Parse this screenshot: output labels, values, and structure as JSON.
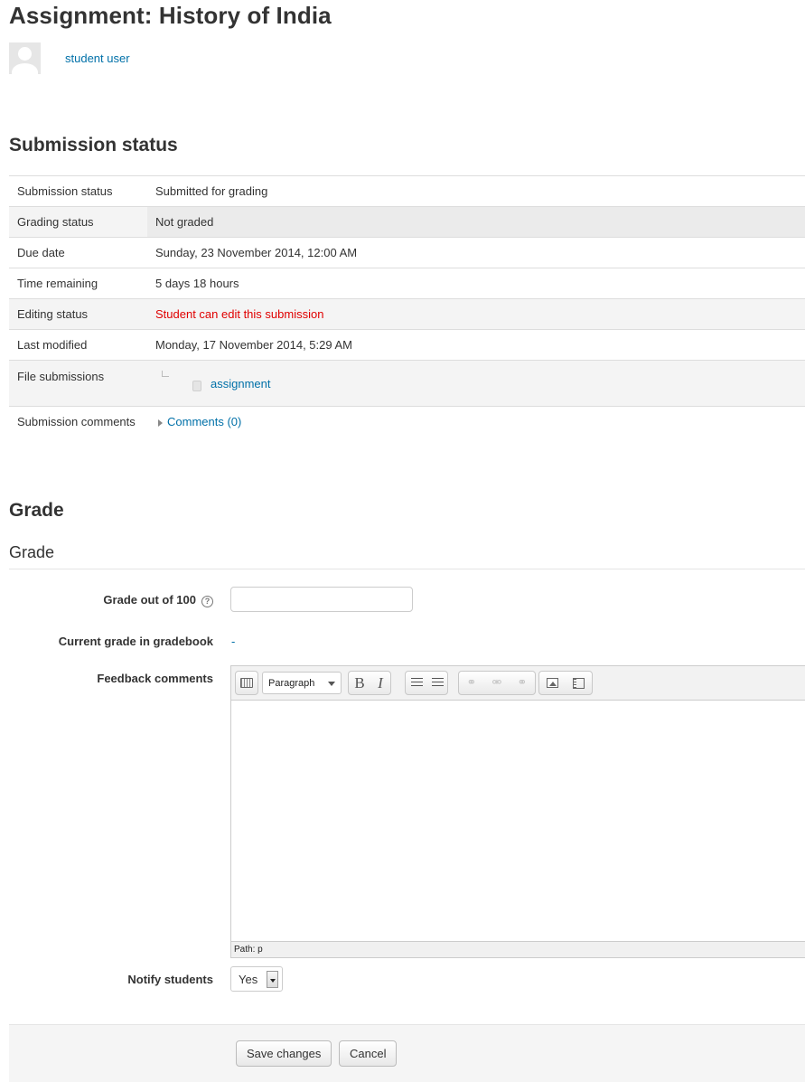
{
  "header": {
    "title": "Assignment: History of India",
    "user_name": "student user"
  },
  "submission": {
    "heading": "Submission status",
    "rows": [
      {
        "label": "Submission status",
        "value": "Submitted for grading"
      },
      {
        "label": "Grading status",
        "value": "Not graded"
      },
      {
        "label": "Due date",
        "value": "Sunday, 23 November 2014, 12:00 AM"
      },
      {
        "label": "Time remaining",
        "value": "5 days 18 hours"
      },
      {
        "label": "Editing status",
        "value": "Student can edit this submission"
      },
      {
        "label": "Last modified",
        "value": "Monday, 17 November 2014, 5:29 AM"
      },
      {
        "label": "File submissions",
        "value": "assignment"
      },
      {
        "label": "Submission comments",
        "value": "Comments (0)"
      }
    ],
    "editing_status_color": "#e00000"
  },
  "grade": {
    "heading": "Grade",
    "legend": "Grade",
    "grade_label": "Grade out of 100",
    "grade_value": "",
    "current_label": "Current grade in gradebook",
    "current_value": "-",
    "feedback_label": "Feedback comments",
    "editor": {
      "format_select": "Paragraph",
      "bold": "B",
      "italic": "I",
      "path": "Path: p"
    },
    "notify_label": "Notify students",
    "notify_value": "Yes"
  },
  "buttons": {
    "save": "Save changes",
    "cancel": "Cancel"
  },
  "colors": {
    "link": "#0070a8",
    "text": "#333333"
  }
}
